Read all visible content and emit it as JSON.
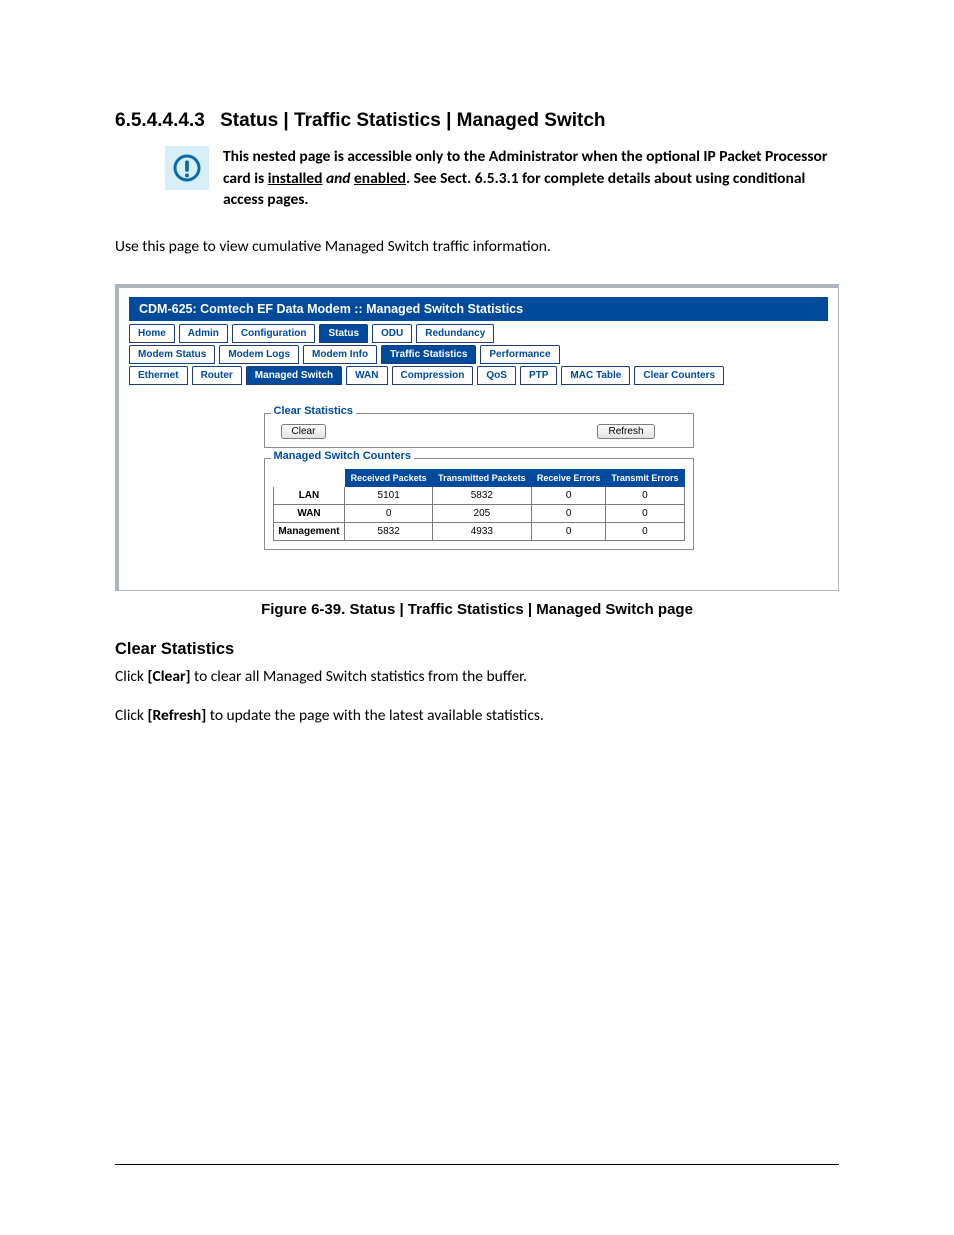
{
  "heading": {
    "number": "6.5.4.4.4.3",
    "title": "Status | Traffic Statistics | Managed Switch"
  },
  "notice": {
    "pre": "This nested page is accessible only to the Administrator when the optional IP Packet Processor card is ",
    "installed": "installed",
    "and": " and ",
    "enabled": "enabled",
    "post": ". See Sect. 6.5.3.1 for complete details about using conditional access pages."
  },
  "lead": "Use this page to view cumulative Managed Switch traffic information.",
  "screenshot": {
    "title": "CDM-625: Comtech EF Data Modem :: Managed Switch Statistics",
    "row1": [
      "Home",
      "Admin",
      "Configuration",
      "Status",
      "ODU",
      "Redundancy"
    ],
    "row1_selected": 3,
    "row2": [
      "Modem Status",
      "Modem Logs",
      "Modem Info",
      "Traffic Statistics",
      "Performance"
    ],
    "row2_selected": 3,
    "row3": [
      "Ethernet",
      "Router",
      "Managed Switch",
      "WAN",
      "Compression",
      "QoS",
      "PTP",
      "MAC Table",
      "Clear Counters"
    ],
    "row3_selected": 2,
    "clear_legend": "Clear Statistics",
    "clear_btn": "Clear",
    "refresh_btn": "Refresh",
    "counters_legend": "Managed Switch Counters",
    "columns": [
      "Received Packets",
      "Transmitted Packets",
      "Receive Errors",
      "Transmit Errors"
    ],
    "rows": [
      {
        "label": "LAN",
        "v": [
          "5101",
          "5832",
          "0",
          "0"
        ]
      },
      {
        "label": "WAN",
        "v": [
          "0",
          "205",
          "0",
          "0"
        ]
      },
      {
        "label": "Management",
        "v": [
          "5832",
          "4933",
          "0",
          "0"
        ]
      }
    ]
  },
  "figcap": "Figure 6-39. Status | Traffic Statistics | Managed Switch page",
  "clear_heading": "Clear Statistics",
  "p1": {
    "a": "Click ",
    "b": "[Clear]",
    "c": " to clear all Managed Switch statistics from the buffer."
  },
  "p2": {
    "a": "Click ",
    "b": "[Refresh]",
    "c": " to update the page with the latest available statistics."
  }
}
